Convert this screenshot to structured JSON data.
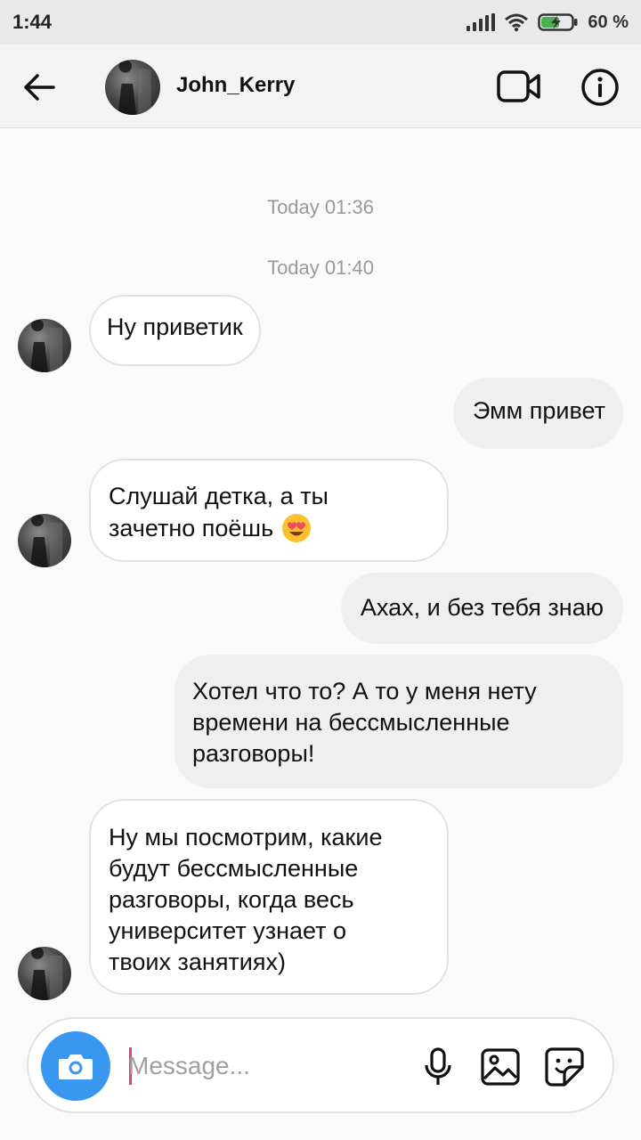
{
  "status_bar": {
    "time": "1:44",
    "battery_percent": "60 %",
    "battery_level": 0.6
  },
  "header": {
    "username": "John_Kerry"
  },
  "timestamps": [
    "Today 01:36",
    "Today 01:40"
  ],
  "messages": [
    {
      "direction": "incoming",
      "text": "Ну приветик"
    },
    {
      "direction": "outgoing",
      "text": "Эмм привет"
    },
    {
      "direction": "incoming",
      "lines": [
        "Слушай детка, а ты",
        "зачетно поёшь"
      ],
      "emoji": "smiling-face-with-heart-eyes"
    },
    {
      "direction": "outgoing",
      "text": "Ахах, и без тебя знаю"
    },
    {
      "direction": "outgoing",
      "lines": [
        "Хотел что то? А то у меня нету",
        "времени на бессмысленные",
        "разговоры!"
      ]
    },
    {
      "direction": "incoming",
      "lines": [
        "Ну мы посмотрим, какие",
        "будут бессмысленные",
        "разговоры, когда весь",
        "университет узнает о",
        "твоих занятиях)"
      ]
    }
  ],
  "composer": {
    "placeholder": "Message...",
    "value": ""
  },
  "colors": {
    "camera_button": "#3a97f0",
    "caret": "#e0437a",
    "incoming_bubble": "#ffffff",
    "outgoing_bubble": "#efefef"
  }
}
